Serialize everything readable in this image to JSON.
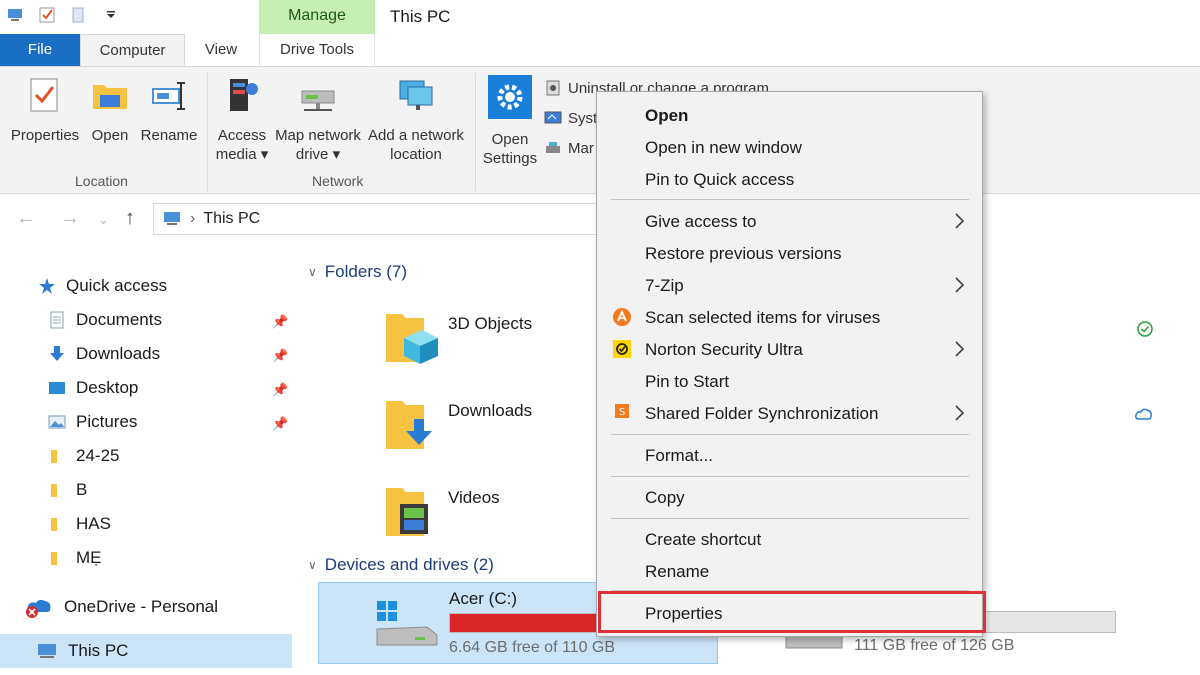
{
  "window": {
    "title": "This PC",
    "manage_tab": "Manage"
  },
  "ribbon_tabs": {
    "file": "File",
    "computer": "Computer",
    "view": "View",
    "drive_tools": "Drive Tools"
  },
  "ribbon": {
    "properties": "Properties",
    "open": "Open",
    "rename": "Rename",
    "access_media_1": "Access",
    "access_media_2": "media ▾",
    "map_drive_1": "Map network",
    "map_drive_2": "drive ▾",
    "add_location_1": "Add a network",
    "add_location_2": "location",
    "open_settings_1": "Open",
    "open_settings_2": "Settings",
    "uninstall": "Uninstall or change a program",
    "system": "Syst",
    "manage": "Mar",
    "group_location": "Location",
    "group_network": "Network"
  },
  "address": {
    "path": "This PC"
  },
  "sidebar": {
    "quick_access": "Quick access",
    "items": [
      "Documents",
      "Downloads",
      "Desktop",
      "Pictures",
      "24-25",
      "B",
      "HAS",
      "MẸ"
    ],
    "onedrive": "OneDrive - Personal",
    "this_pc": "This PC"
  },
  "main": {
    "folders_header": "Folders (7)",
    "folders": [
      "3D Objects",
      "Downloads",
      "Videos"
    ],
    "devices_header": "Devices and drives (2)",
    "drive_c": {
      "name": "Acer (C:)",
      "free": "6.64 GB free of 110 GB",
      "used_fraction": 0.94
    },
    "drive_d": {
      "free": "111 GB free of 126 GB"
    }
  },
  "context_menu": {
    "open": "Open",
    "open_new_window": "Open in new window",
    "pin_quick": "Pin to Quick access",
    "give_access": "Give access to",
    "restore": "Restore previous versions",
    "zip": "7-Zip",
    "scan": "Scan selected items for viruses",
    "norton": "Norton Security Ultra",
    "pin_start": "Pin to Start",
    "shared_sync": "Shared Folder Synchronization",
    "format": "Format...",
    "copy": "Copy",
    "create_shortcut": "Create shortcut",
    "rename": "Rename",
    "properties": "Properties"
  },
  "colors": {
    "accent": "#1a6fc4",
    "manage": "#c6efb4",
    "selection": "#cce4f7",
    "drive_used": "#da2626",
    "highlight": "#e0303a"
  }
}
